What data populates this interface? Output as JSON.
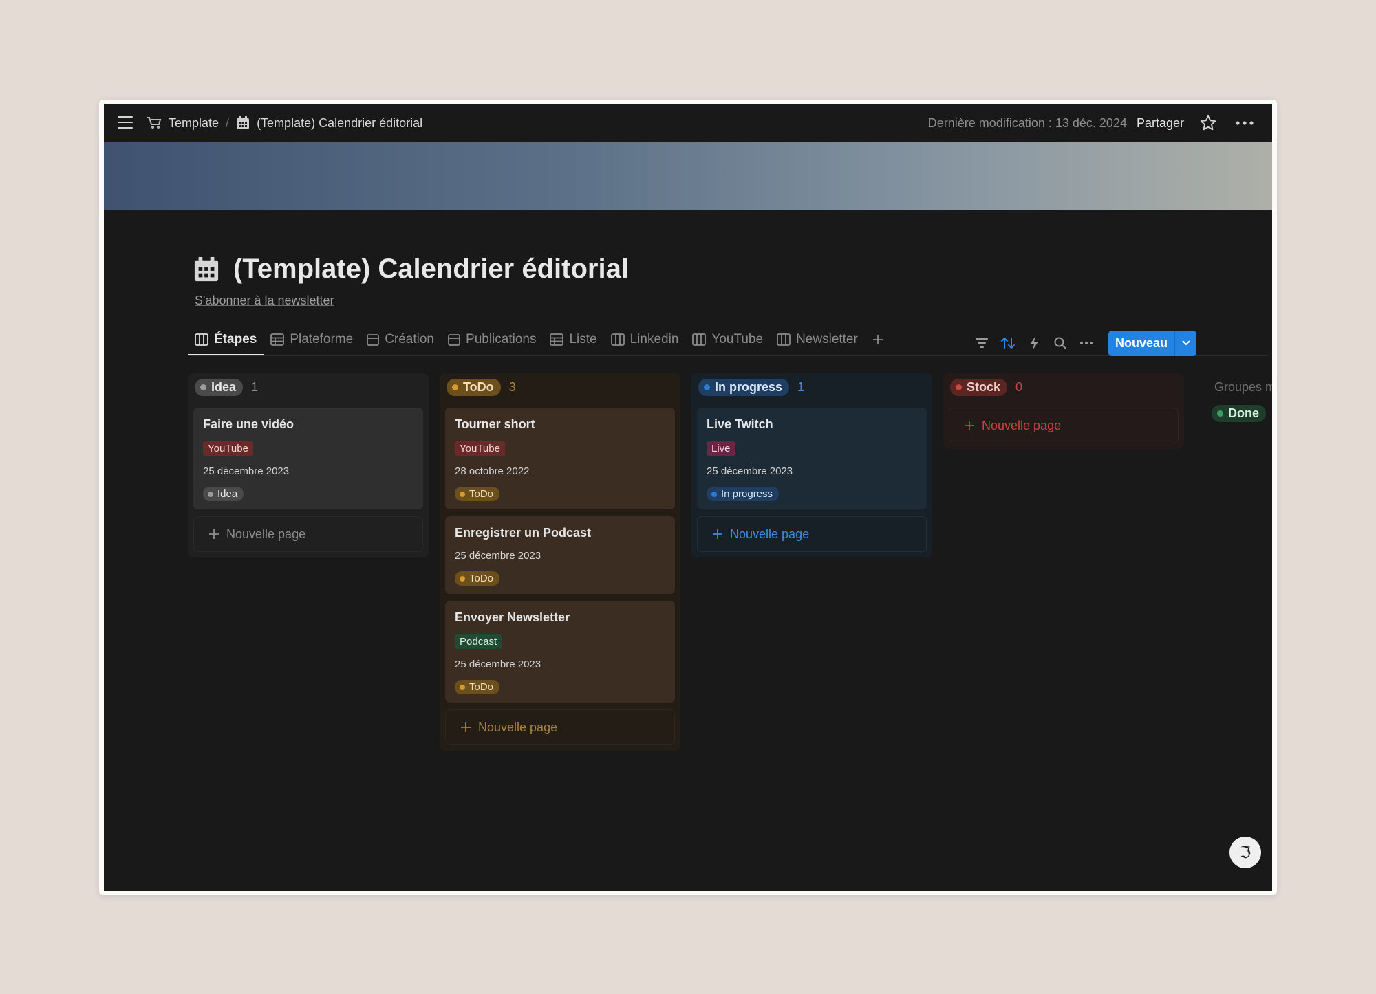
{
  "topbar": {
    "breadcrumb": [
      {
        "icon": "cart-icon",
        "label": "Template"
      },
      {
        "icon": "calendar-icon",
        "label": "(Template) Calendrier éditorial"
      }
    ],
    "separator": "/",
    "last_modified": "Dernière modification : 13 déc. 2024",
    "share_label": "Partager"
  },
  "page": {
    "title": "(Template) Calendrier éditorial",
    "subtitle_link": "S'abonner à la newsletter"
  },
  "tabs": [
    {
      "label": "Étapes",
      "icon": "board-icon",
      "active": true
    },
    {
      "label": "Plateforme",
      "icon": "table-icon"
    },
    {
      "label": "Création",
      "icon": "calendar-view-icon"
    },
    {
      "label": "Publications",
      "icon": "calendar-view-icon"
    },
    {
      "label": "Liste",
      "icon": "table-icon"
    },
    {
      "label": "Linkedin",
      "icon": "board-icon"
    },
    {
      "label": "YouTube",
      "icon": "board-icon"
    },
    {
      "label": "Newsletter",
      "icon": "board-icon"
    }
  ],
  "toolbar": {
    "new_label": "Nouveau"
  },
  "columns": [
    {
      "status": "Idea",
      "count": "1",
      "cards": [
        {
          "title": "Faire une vidéo",
          "tag": "YouTube",
          "date": "25 décembre 2023",
          "status": "Idea"
        }
      ],
      "new_page": "Nouvelle page"
    },
    {
      "status": "ToDo",
      "count": "3",
      "cards": [
        {
          "title": "Tourner short",
          "tag": "YouTube",
          "date": "28 octobre 2022",
          "status": "ToDo"
        },
        {
          "title": "Enregistrer un Podcast",
          "date": "25 décembre 2023",
          "status": "ToDo"
        },
        {
          "title": "Envoyer Newsletter",
          "tag": "Podcast",
          "date": "25 décembre 2023",
          "status": "ToDo"
        }
      ],
      "new_page": "Nouvelle page"
    },
    {
      "status": "In progress",
      "count": "1",
      "cards": [
        {
          "title": "Live Twitch",
          "tag": "Live",
          "date": "25 décembre 2023",
          "status": "In progress"
        }
      ],
      "new_page": "Nouvelle page"
    },
    {
      "status": "Stock",
      "count": "0",
      "cards": [],
      "new_page": "Nouvelle page"
    }
  ],
  "hidden_groups": {
    "label": "Groupes ma",
    "items": [
      "Done"
    ]
  },
  "colors": {
    "accent": "#2383e2",
    "idea": "#9b9b9b",
    "todo": "#d59b2d",
    "in_progress": "#2e7cd6",
    "stock": "#d0463f",
    "done": "#3a9e63"
  }
}
